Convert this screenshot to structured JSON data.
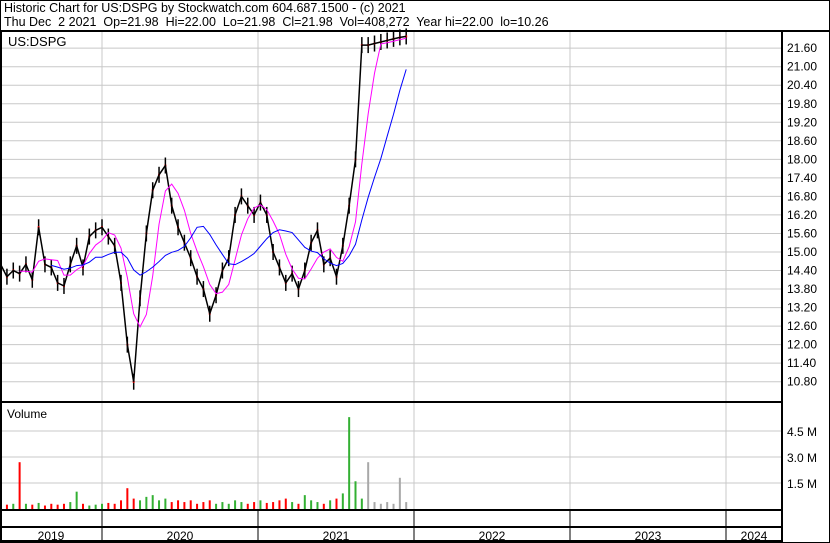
{
  "header": {
    "title": "Historic Chart for US:DSPG by Stockwatch.com 604.687.1500 - (c) 2021",
    "quote_line": "Thu Dec  2 2021  Op=21.98  Hi=22.00  Lo=21.98  Cl=21.98  Vol=408,272  Year hi=22.00  lo=10.26"
  },
  "chart_data": {
    "type": "line",
    "title": "US:DSPG",
    "volume_title": "Volume",
    "symbol": "US:DSPG",
    "x_start_year": 2019.35,
    "x_end_year": 2021.95,
    "x_axis_years": [
      "2019",
      "2020",
      "2021",
      "2022",
      "2023",
      "2024"
    ],
    "price_ticks": [
      "21.60",
      "21.00",
      "20.40",
      "19.80",
      "19.20",
      "18.60",
      "18.00",
      "17.40",
      "16.80",
      "16.20",
      "15.60",
      "15.00",
      "14.40",
      "13.80",
      "13.20",
      "12.60",
      "12.00",
      "11.40",
      "10.80"
    ],
    "price_range": [
      10.8,
      21.6
    ],
    "volume_ticks": [
      "4.5 M",
      "3.0 M",
      "1.5 M"
    ],
    "volume_range_millions": [
      0,
      6
    ],
    "close": [
      14.6,
      14.2,
      14.4,
      14.3,
      14.6,
      14.1,
      15.8,
      14.6,
      14.5,
      14.0,
      13.9,
      14.6,
      15.2,
      14.5,
      15.5,
      15.7,
      15.8,
      15.5,
      15.2,
      14.0,
      12.0,
      10.8,
      13.5,
      15.6,
      17.0,
      17.5,
      17.8,
      16.5,
      15.8,
      15.3,
      14.8,
      14.2,
      13.8,
      13.0,
      13.6,
      14.4,
      14.8,
      16.2,
      16.8,
      16.5,
      16.2,
      16.6,
      16.2,
      15.0,
      14.5,
      14.0,
      14.3,
      13.8,
      14.4,
      15.3,
      15.7,
      14.6,
      14.8,
      14.2,
      15.2,
      16.5,
      18.0,
      21.7,
      21.7,
      21.75,
      21.8,
      21.85,
      21.9,
      21.95,
      21.98
    ],
    "volume_millions": [
      0.2,
      0.25,
      0.3,
      2.7,
      0.3,
      0.25,
      0.35,
      0.2,
      0.3,
      0.25,
      0.3,
      0.4,
      1.0,
      0.3,
      0.2,
      0.25,
      0.3,
      0.35,
      0.3,
      0.5,
      1.2,
      0.6,
      0.5,
      0.7,
      0.8,
      0.5,
      0.6,
      0.4,
      0.5,
      0.4,
      0.5,
      0.3,
      0.4,
      0.5,
      0.3,
      0.4,
      0.3,
      0.5,
      0.4,
      0.3,
      0.4,
      0.5,
      0.35,
      0.4,
      0.5,
      0.6,
      0.4,
      0.3,
      0.8,
      0.5,
      0.4,
      0.3,
      0.5,
      0.6,
      0.9,
      5.3,
      1.6,
      0.6,
      2.7,
      0.4,
      0.3,
      0.4,
      0.3,
      1.8,
      0.4
    ],
    "ma_short_periods": 4,
    "ma_long_periods": 10,
    "colors": {
      "price": "#000000",
      "ma_short": "#ff00ff",
      "ma_long": "#0000ff",
      "vol_up": "#33b033",
      "vol_down": "#ff0000",
      "vol_flat": "#a8a8a8",
      "grid": "#c8c8c8"
    }
  }
}
